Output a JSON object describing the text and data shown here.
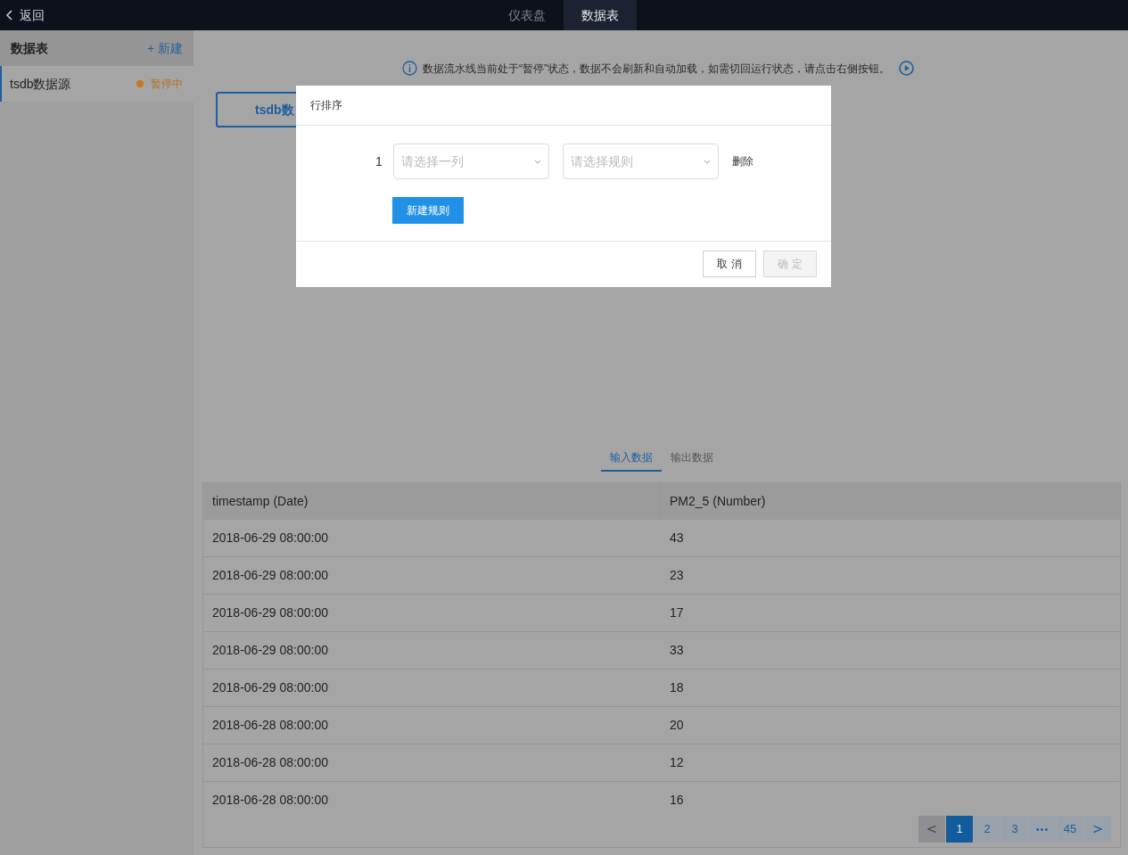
{
  "top_bar": {
    "back_label": "返回",
    "tabs": [
      {
        "label": "仪表盘",
        "selected": false
      },
      {
        "label": "数据表",
        "selected": true
      }
    ]
  },
  "sidebar": {
    "title": "数据表",
    "new_label": "+ 新建",
    "items": [
      {
        "name": "tsdb数据源",
        "status": "暂停中",
        "selected": true
      }
    ]
  },
  "notice": "数据流水线当前处于“暂停”状态，数据不会刷新和自动加载，如需切回运行状态，请点击右侧按钮。",
  "source_button": "tsdb数",
  "data_tabs": [
    {
      "label": "输入数据",
      "selected": true
    },
    {
      "label": "输出数据",
      "selected": false
    }
  ],
  "table": {
    "columns": [
      "timestamp (Date)",
      "PM2_5 (Number)"
    ],
    "rows": [
      [
        "2018-06-29 08:00:00",
        "43"
      ],
      [
        "2018-06-29 08:00:00",
        "23"
      ],
      [
        "2018-06-29 08:00:00",
        "17"
      ],
      [
        "2018-06-29 08:00:00",
        "33"
      ],
      [
        "2018-06-29 08:00:00",
        "18"
      ],
      [
        "2018-06-28 08:00:00",
        "20"
      ],
      [
        "2018-06-28 08:00:00",
        "12"
      ],
      [
        "2018-06-28 08:00:00",
        "16"
      ]
    ]
  },
  "pagination": [
    {
      "kind": "prev",
      "label": "<",
      "selected": false,
      "disabled": true
    },
    {
      "kind": "page",
      "label": "1",
      "selected": true,
      "disabled": false
    },
    {
      "kind": "page",
      "label": "2",
      "selected": false,
      "disabled": false
    },
    {
      "kind": "page",
      "label": "3",
      "selected": false,
      "disabled": false
    },
    {
      "kind": "more",
      "label": "•••",
      "selected": false,
      "disabled": false
    },
    {
      "kind": "page",
      "label": "45",
      "selected": false,
      "disabled": false
    },
    {
      "kind": "next",
      "label": ">",
      "selected": false,
      "disabled": false
    }
  ],
  "dialog": {
    "title": "行排序",
    "rules": [
      {
        "index": "1",
        "column_placeholder": "请选择一列",
        "rule_placeholder": "请选择规则",
        "delete_label": "删除"
      }
    ],
    "add_rule_label": "新建规则",
    "buttons": [
      {
        "label": "取 消",
        "disabled": false
      },
      {
        "label": "确 定",
        "disabled": true
      }
    ]
  }
}
